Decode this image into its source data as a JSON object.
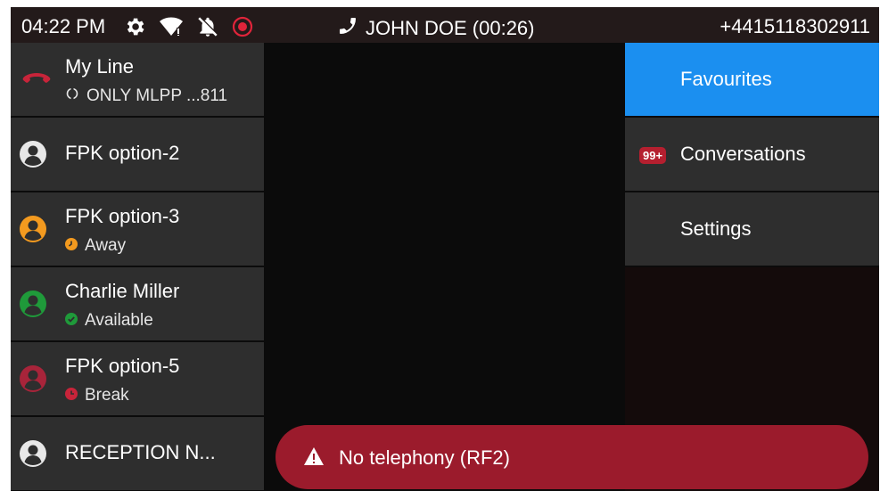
{
  "status_bar": {
    "time": "04:22 PM",
    "icons": [
      "gear-icon",
      "wifi-icon",
      "bell-muted-icon",
      "record-icon"
    ],
    "call_label": "JOHN DOE (00:26)",
    "number": "+4415118302911"
  },
  "keys": [
    {
      "label": "My Line",
      "sub": "ONLY MLPP ...811",
      "icon": "handset-hangup-icon"
    },
    {
      "label": "FPK option-2",
      "sub": null,
      "icon": "avatar-icon",
      "avatar_color": "#e8e8e8"
    },
    {
      "label": "FPK option-3",
      "sub": "Away",
      "icon": "avatar-icon",
      "avatar_color": "#f39a1f",
      "status_color": "#f39a1f"
    },
    {
      "label": "Charlie Miller",
      "sub": "Available",
      "icon": "avatar-icon",
      "avatar_color": "#1f9a3a",
      "status_color": "#1f9a3a"
    },
    {
      "label": "FPK option-5",
      "sub": "Break",
      "icon": "avatar-icon",
      "avatar_color": "#a8243a",
      "status_color": "#c8243a"
    },
    {
      "label": "RECEPTION N...",
      "sub": null,
      "icon": "avatar-icon",
      "avatar_color": "#e8e8e8"
    }
  ],
  "menu": [
    {
      "label": "Favourites",
      "active": true
    },
    {
      "label": "Conversations",
      "badge": "99+"
    },
    {
      "label": "Settings"
    }
  ],
  "notification": {
    "text": "No telephony (RF2)",
    "icon": "warning-icon",
    "color": "#9b1b2c"
  },
  "colors": {
    "accent": "#1b8ff0",
    "panel": "#2e2e2e",
    "background": "#0b0b0b"
  }
}
